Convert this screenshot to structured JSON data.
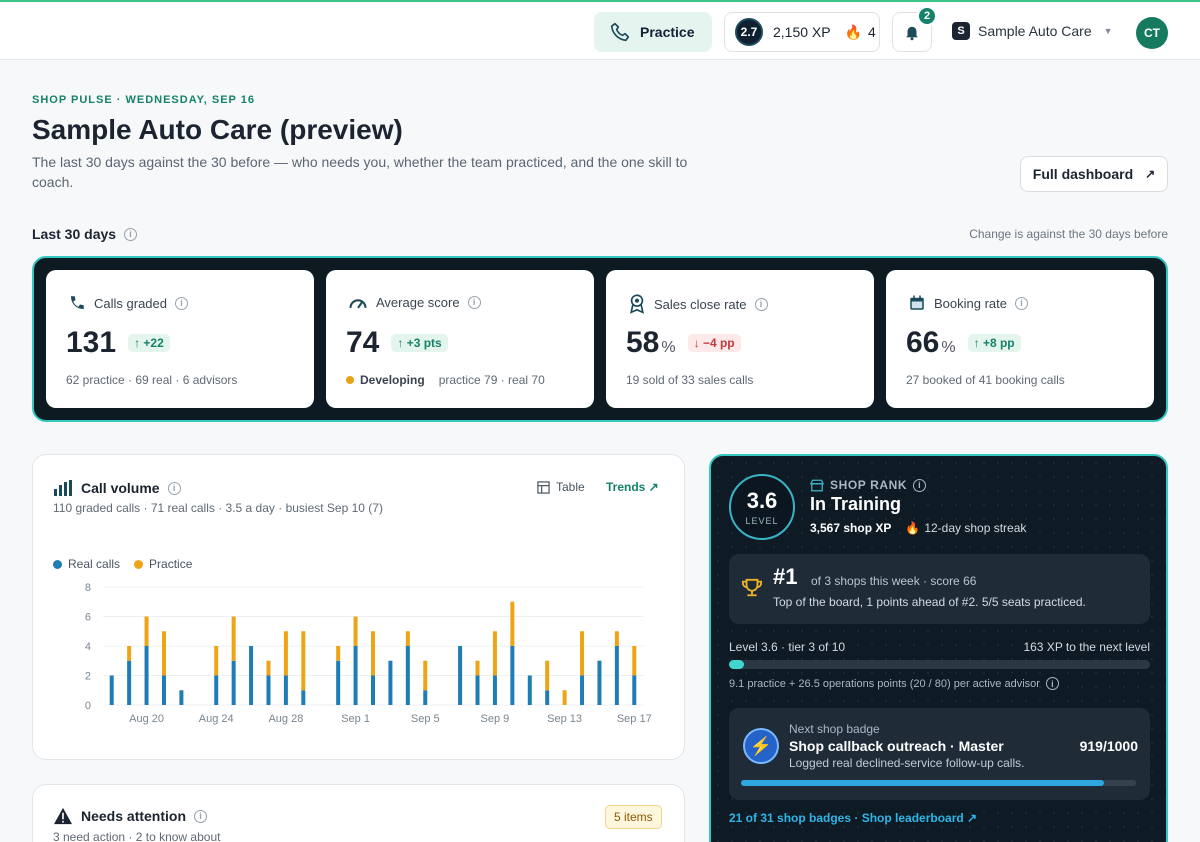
{
  "topbar": {
    "practice_label": "Practice",
    "level": "2.7",
    "xp": "2,150 XP",
    "streak": "4",
    "notifications": "2",
    "shop_initial": "S",
    "shop_name": "Sample Auto Care",
    "avatar_initials": "CT"
  },
  "header": {
    "eyebrow": "SHOP PULSE · WEDNESDAY, SEP 16",
    "title": "Sample Auto Care (preview)",
    "subtitle": "The last 30 days against the 30 before — who needs you, whether the team practiced, and the one skill to coach.",
    "full_dashboard_label": "Full dashboard"
  },
  "period": {
    "label": "Last 30 days",
    "change_note": "Change is against the 30 days before"
  },
  "kpis": [
    {
      "label": "Calls graded",
      "value": "131",
      "unit": "",
      "delta": "↑ +22",
      "direction": "up",
      "footer": "62 practice · 69 real · 6 advisors"
    },
    {
      "label": "Average score",
      "value": "74",
      "unit": "",
      "delta": "↑ +3 pts",
      "direction": "up",
      "status": "Developing",
      "footer": "practice 79 · real 70"
    },
    {
      "label": "Sales close rate",
      "value": "58",
      "unit": "%",
      "delta": "↓ −4 pp",
      "direction": "down",
      "footer": "19 sold of 33 sales calls"
    },
    {
      "label": "Booking rate",
      "value": "66",
      "unit": "%",
      "delta": "↑ +8 pp",
      "direction": "up",
      "footer": "27 booked of 41 booking calls"
    }
  ],
  "call_volume": {
    "title": "Call volume",
    "subtitle": "110 graded calls · 71 real calls · 3.5 a day · busiest Sep 10 (7)",
    "table_label": "Table",
    "trends_label": "Trends ↗",
    "legend": [
      "Real calls",
      "Practice"
    ]
  },
  "chart_data": {
    "type": "bar",
    "stacked": true,
    "categories": [
      "Aug 18",
      "Aug 19",
      "Aug 20",
      "Aug 21",
      "Aug 22",
      "Aug 23",
      "Aug 24",
      "Aug 25",
      "Aug 26",
      "Aug 27",
      "Aug 28",
      "Aug 29",
      "Aug 30",
      "Aug 31",
      "Sep 1",
      "Sep 2",
      "Sep 3",
      "Sep 4",
      "Sep 5",
      "Sep 6",
      "Sep 7",
      "Sep 8",
      "Sep 9",
      "Sep 10",
      "Sep 11",
      "Sep 12",
      "Sep 13",
      "Sep 14",
      "Sep 15",
      "Sep 16",
      "Sep 17"
    ],
    "tick_labels": [
      "Aug 20",
      "Aug 24",
      "Aug 28",
      "Sep 1",
      "Sep 5",
      "Sep 9",
      "Sep 13",
      "Sep 17"
    ],
    "series": [
      {
        "name": "Real calls",
        "color": "#1f7db5",
        "values": [
          2,
          3,
          4,
          2,
          1,
          0,
          2,
          3,
          4,
          2,
          2,
          1,
          0,
          3,
          4,
          2,
          3,
          4,
          1,
          0,
          4,
          2,
          2,
          4,
          2,
          1,
          0,
          2,
          3,
          4,
          2
        ]
      },
      {
        "name": "Practice",
        "color": "#eda416",
        "values": [
          0,
          1,
          2,
          3,
          0,
          0,
          2,
          3,
          0,
          1,
          3,
          4,
          0,
          1,
          2,
          3,
          0,
          1,
          2,
          0,
          0,
          1,
          3,
          3,
          0,
          2,
          1,
          3,
          0,
          1,
          2
        ]
      }
    ],
    "yticks": [
      0,
      2,
      4,
      6,
      8
    ],
    "ylim": [
      0,
      8
    ]
  },
  "needs_attention": {
    "title": "Needs attention",
    "subtitle": "3 need action · 2 to know about",
    "badge": "5 items"
  },
  "rank": {
    "level": "3.6",
    "level_label": "LEVEL",
    "eyebrow": "SHOP RANK",
    "title": "In Training",
    "shop_xp": "3,567 shop XP",
    "streak": "12-day shop streak",
    "position": "#1",
    "position_context": "of 3 shops this week · score 66",
    "position_desc": "Top of the board, 1 points ahead of #2. 5/5 seats practiced.",
    "progress_left": "Level 3.6 · tier 3 of 10",
    "progress_right": "163 XP to the next level",
    "progress_fraction": 0.035,
    "progress_note": "9.1 practice + 26.5 operations points (20 / 80) per active advisor",
    "badge_next": "Next shop badge",
    "badge_name": "Shop callback outreach · Master",
    "badge_count": "919/1000",
    "badge_desc": "Logged real declined-service follow-up calls.",
    "badge_fraction": 0.919,
    "links": "21 of 31 shop badges · Shop leaderboard ↗"
  }
}
